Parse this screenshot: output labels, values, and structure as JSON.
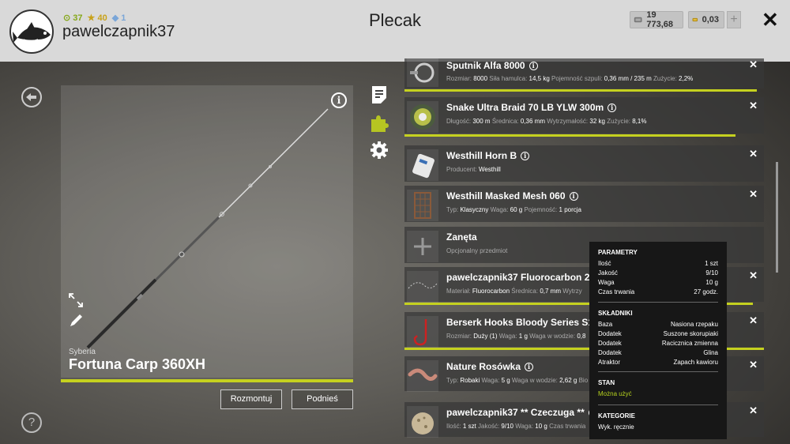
{
  "header": {
    "title": "Plecak",
    "username": "pawelczapnik37",
    "stats": {
      "level": "37",
      "stars": "40",
      "rank": "1"
    },
    "silver": "19 773,68",
    "gold": "0,03",
    "plus_label": "+",
    "close_label": "✕"
  },
  "rod": {
    "region": "Syberia",
    "name": "Fortuna Carp 360XH",
    "condition": 1.0,
    "info_label": "i",
    "disassemble_label": "Rozmontuj",
    "pickup_label": "Podnieś"
  },
  "help_label": "?",
  "items": [
    {
      "name": "Sputnik Alfa 8000",
      "props": [
        [
          "Rozmiar:",
          "8000"
        ],
        [
          "Siła hamulca:",
          "14,5 kg"
        ],
        [
          "Pojemność szpuli:",
          "0,36 mm / 235 m"
        ],
        [
          "Zużycie:",
          "2,2%"
        ]
      ],
      "wear_fill": 0.98
    },
    {
      "name": "Snake Ultra Braid 70 LB YLW 300m",
      "props": [
        [
          "Długość:",
          "300 m"
        ],
        [
          "Średnica:",
          "0,36 mm"
        ],
        [
          "Wytrzymałość:",
          "32 kg"
        ],
        [
          "Zużycie:",
          "8,1%"
        ]
      ],
      "wear_fill": 0.92
    },
    {
      "name": "Westhill Horn B",
      "props": [
        [
          "Producent:",
          "Westhill"
        ]
      ]
    },
    {
      "name": "Westhill Masked Mesh 060",
      "props": [
        [
          "Typ:",
          "Klasyczny"
        ],
        [
          "Waga:",
          "60 g"
        ],
        [
          "Pojemność:",
          "1 porcja"
        ]
      ]
    },
    {
      "name": "Zanęta",
      "props": [
        [
          "Opcjonalny przedmiot",
          ""
        ]
      ],
      "no_info": true
    },
    {
      "name": "pawelczapnik37 Fluorocarbon 27,",
      "props": [
        [
          "Materiał:",
          "Fluorocarbon"
        ],
        [
          "Średnica:",
          "0,7 mm"
        ],
        [
          "Wytrzy",
          ""
        ]
      ],
      "wear_fill": 0.97
    },
    {
      "name": "Berserk Hooks Bloody Series S1",
      "props": [
        [
          "Rozmiar:",
          "Duży (1)"
        ],
        [
          "Waga:",
          "1 g"
        ],
        [
          "Waga w wodzie:",
          "0,8"
        ]
      ],
      "wear_fill": 1.0
    },
    {
      "name": "Nature Rosówka",
      "props": [
        [
          "Typ:",
          "Robaki"
        ],
        [
          "Waga:",
          "5 g"
        ],
        [
          "Waga w wodzie:",
          "2,62 g"
        ],
        [
          "Bio",
          ""
        ]
      ]
    },
    {
      "name": "pawelczapnik37 ** Czeczuga **",
      "props": [
        [
          "Ilość:",
          "1 szt"
        ],
        [
          "Jakość:",
          "9/10"
        ],
        [
          "Waga:",
          "10 g"
        ],
        [
          "Czas trwania",
          ""
        ]
      ]
    }
  ],
  "tooltip": {
    "params_title": "PARAMETRY",
    "params": [
      [
        "Ilość",
        "1 szt"
      ],
      [
        "Jakość",
        "9/10"
      ],
      [
        "Waga",
        "10 g"
      ],
      [
        "Czas trwania",
        "27 godz."
      ]
    ],
    "ingredients_title": "SKŁADNIKI",
    "ingredients": [
      [
        "Baza",
        "Nasiona rzepaku"
      ],
      [
        "Dodatek",
        "Suszone skorupiaki"
      ],
      [
        "Dodatek",
        "Racicznica zmienna"
      ],
      [
        "Dodatek",
        "Glina"
      ],
      [
        "Atraktor",
        "Zapach kawioru"
      ]
    ],
    "state_title": "STAN",
    "state_value": "Można użyć",
    "category_title": "KATEGORIE",
    "category_value": "Wyk. ręcznie"
  },
  "colors": {
    "accent": "#c5d11f",
    "topbar": "#d9d9d9",
    "tooltip_bg": "#171717"
  },
  "icons": {
    "back": "back-arrow-icon",
    "help": "question-icon",
    "notes": "notes-icon",
    "puzzle": "puzzle-icon",
    "settings": "gear-icon"
  }
}
